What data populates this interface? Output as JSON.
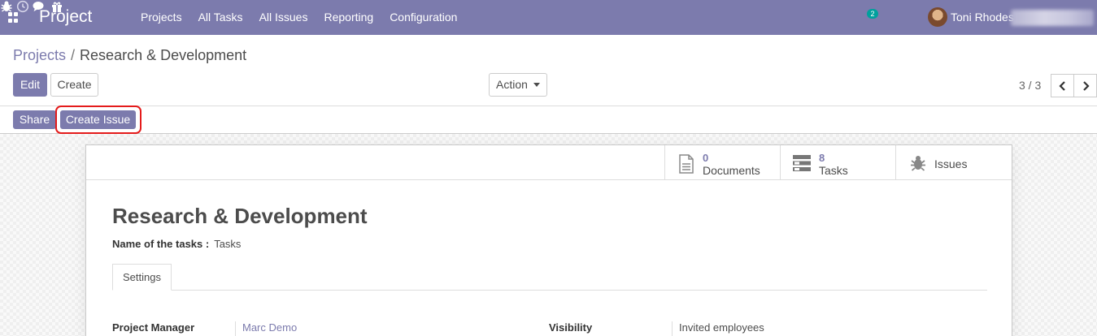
{
  "app": {
    "name": "Project"
  },
  "menu": [
    "Projects",
    "All Tasks",
    "All Issues",
    "Reporting",
    "Configuration"
  ],
  "systray": {
    "message_count": "2",
    "user_name": "Toni Rhodes"
  },
  "breadcrumb": {
    "parent": "Projects",
    "separator": "/",
    "current": "Research & Development"
  },
  "buttons": {
    "edit": "Edit",
    "create": "Create",
    "action": "Action",
    "share": "Share",
    "create_issue": "Create Issue"
  },
  "pager": {
    "value": "3 / 3"
  },
  "stat_buttons": {
    "documents": {
      "value": "0",
      "label": "Documents"
    },
    "tasks": {
      "value": "8",
      "label": "Tasks"
    },
    "issues": {
      "label": "Issues"
    }
  },
  "record": {
    "title": "Research & Development",
    "task_name_label": "Name of the tasks :",
    "task_name_value": "Tasks"
  },
  "tabs": [
    "Settings"
  ],
  "fields": {
    "project_manager": {
      "label": "Project Manager",
      "value": "Marc Demo"
    },
    "visibility": {
      "label": "Visibility",
      "value": "Invited employees"
    }
  },
  "colors": {
    "brand": "#7c7bad",
    "highlight": "#e41b1b",
    "badge": "#00a09d"
  }
}
